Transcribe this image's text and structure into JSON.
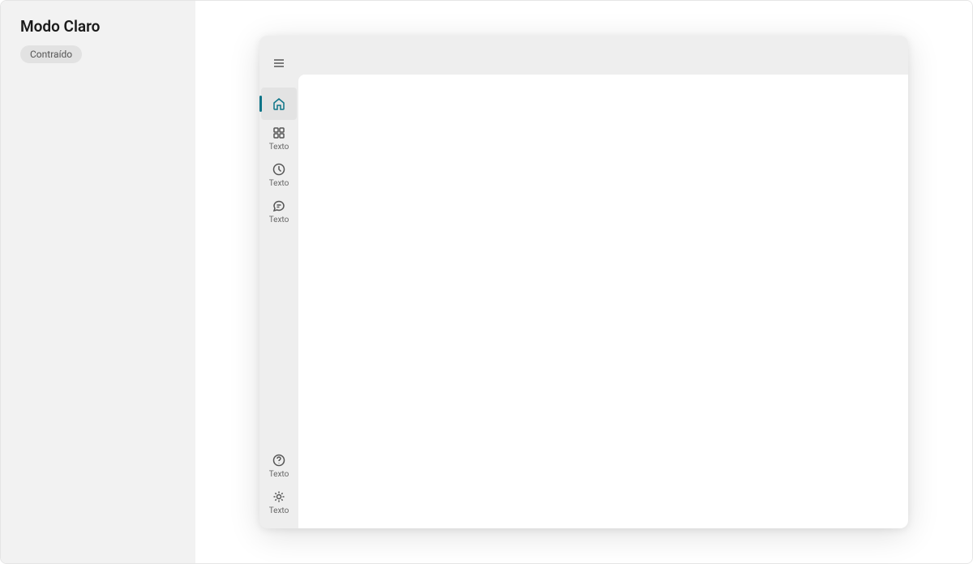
{
  "panel": {
    "title": "Modo Claro",
    "tag": "Contraído"
  },
  "sidebar": {
    "top_items": [
      {
        "id": "home",
        "label": "",
        "selected": true
      },
      {
        "id": "apps",
        "label": "Texto",
        "selected": false
      },
      {
        "id": "recent",
        "label": "Texto",
        "selected": false
      },
      {
        "id": "chat",
        "label": "Texto",
        "selected": false
      }
    ],
    "bottom_items": [
      {
        "id": "help",
        "label": "Texto"
      },
      {
        "id": "settings",
        "label": "Texto"
      }
    ]
  },
  "colors": {
    "accent": "#0d7488",
    "panel_bg": "#f2f2f2",
    "window_bg": "#eeeeee",
    "selected_bg": "#e3e3e3"
  }
}
